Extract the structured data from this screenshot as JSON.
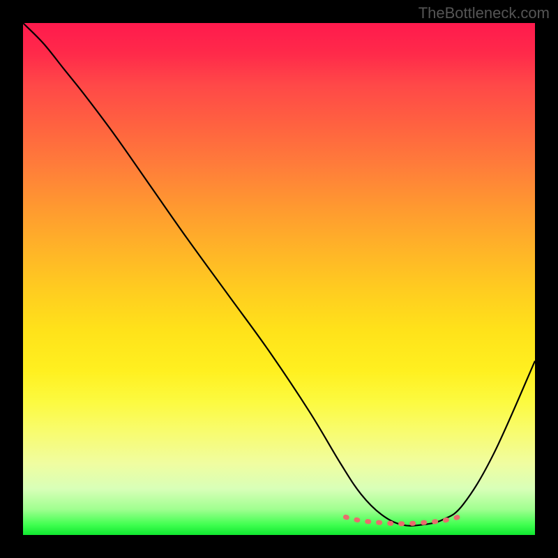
{
  "watermark": "TheBottleneck.com",
  "chart_data": {
    "type": "line",
    "title": "",
    "xlabel": "",
    "ylabel": "",
    "xlim": [
      0,
      100
    ],
    "ylim": [
      0,
      100
    ],
    "series": [
      {
        "name": "bottleneck-curve",
        "x": [
          0,
          4,
          8,
          12,
          18,
          25,
          32,
          40,
          48,
          56,
          62,
          66,
          70,
          74,
          78,
          82,
          86,
          92,
          100
        ],
        "y": [
          100,
          96,
          91,
          86,
          78,
          68,
          58,
          47,
          36,
          24,
          14,
          8,
          4,
          2,
          2,
          3,
          6,
          16,
          34
        ]
      },
      {
        "name": "highlight-band",
        "x": [
          63,
          66,
          70,
          74,
          78,
          82,
          85
        ],
        "y": [
          3.5,
          2.8,
          2.4,
          2.2,
          2.4,
          2.8,
          3.5
        ]
      }
    ],
    "gradient_stops": [
      {
        "pos": 0,
        "color": "#ff1a4d"
      },
      {
        "pos": 50,
        "color": "#ffcc20"
      },
      {
        "pos": 80,
        "color": "#f8fc70"
      },
      {
        "pos": 100,
        "color": "#10e830"
      }
    ]
  }
}
